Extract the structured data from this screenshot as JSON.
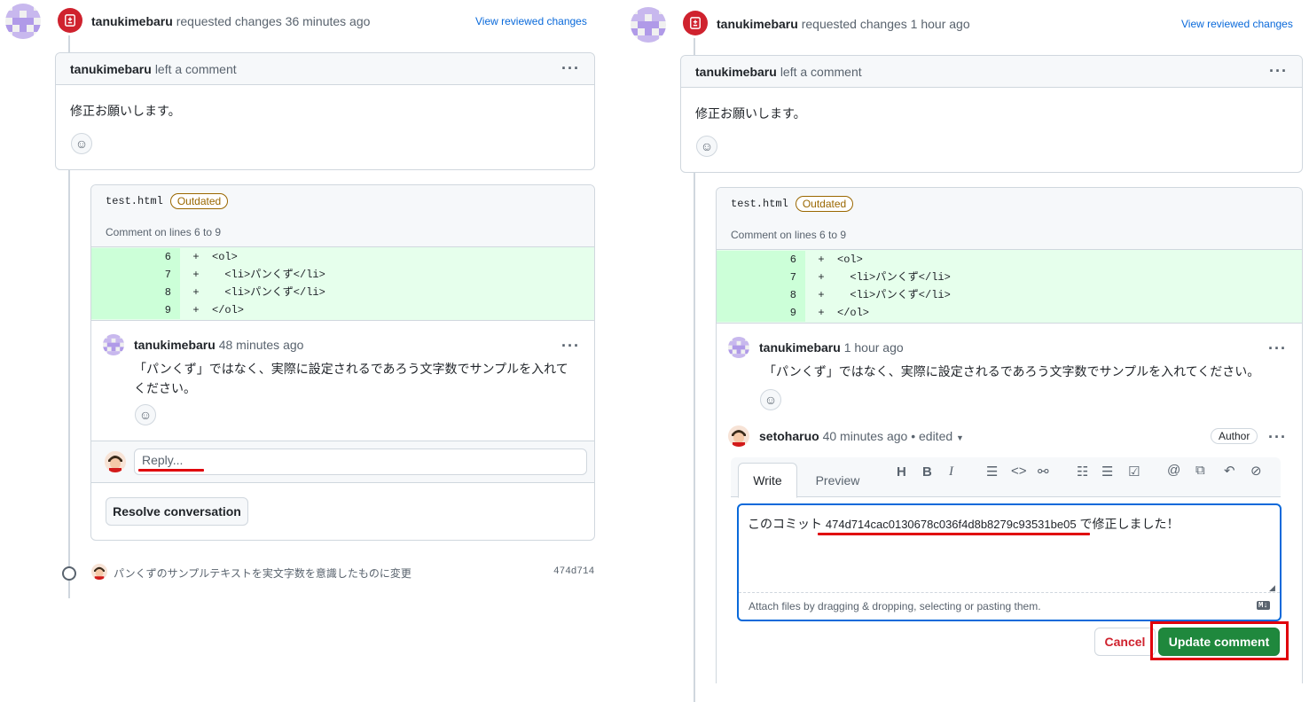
{
  "colors": {
    "accent": "#0969da",
    "danger": "#cf222e",
    "success": "#1f883d",
    "outdated": "#9a6700",
    "diff_add": "#e6ffec",
    "highlight_red": "#e0000b"
  },
  "left": {
    "review": {
      "user": "tanukimebaru",
      "action": "requested changes 36 minutes ago",
      "link": "View reviewed changes"
    },
    "comment": {
      "user": "tanukimebaru",
      "action": "left a comment",
      "body": "修正お願いします。"
    },
    "thread": {
      "file": "test.html",
      "badge": "Outdated",
      "lines_label": "Comment on lines 6 to 9",
      "diff": [
        {
          "num": "6",
          "sign": "+",
          "code": "<ol>"
        },
        {
          "num": "7",
          "sign": "+",
          "code": "  <li>パンくず</li>"
        },
        {
          "num": "8",
          "sign": "+",
          "code": "  <li>パンくず</li>"
        },
        {
          "num": "9",
          "sign": "+",
          "code": "</ol>"
        }
      ],
      "reply": {
        "user": "tanukimebaru",
        "time": "48 minutes ago",
        "body": "「パンくず」ではなく、実際に設定されるであろう文字数でサンプルを入れてください。"
      },
      "reply_placeholder": "Reply...",
      "resolve_label": "Resolve conversation"
    },
    "commit": {
      "message": "パンくずのサンプルテキストを実文字数を意識したものに変更",
      "sha": "474d714"
    }
  },
  "right": {
    "review": {
      "user": "tanukimebaru",
      "action": "requested changes 1 hour ago",
      "link": "View reviewed changes"
    },
    "comment": {
      "user": "tanukimebaru",
      "action": "left a comment",
      "body": "修正お願いします。"
    },
    "thread": {
      "file": "test.html",
      "badge": "Outdated",
      "lines_label": "Comment on lines 6 to 9",
      "diff": [
        {
          "num": "6",
          "sign": "+",
          "code": "<ol>"
        },
        {
          "num": "7",
          "sign": "+",
          "code": "  <li>パンくず</li>"
        },
        {
          "num": "8",
          "sign": "+",
          "code": "  <li>パンくず</li>"
        },
        {
          "num": "9",
          "sign": "+",
          "code": "</ol>"
        }
      ],
      "reply": {
        "user": "tanukimebaru",
        "time": "1 hour ago",
        "body": "「パンくず」ではなく、実際に設定されるであろう文字数でサンプルを入れてください。"
      },
      "edit": {
        "user": "setoharuo",
        "time": "40 minutes ago",
        "edited": "• edited",
        "role": "Author",
        "tabs": {
          "write": "Write",
          "preview": "Preview"
        },
        "text_prefix": "このコミット ",
        "sha": "474d714cac0130678c036f4d8b8279c93531be05",
        "text_suffix": " で修正しました！",
        "attach": "Attach files by dragging & dropping, selecting or pasting them.",
        "md_badge": "M↓",
        "cancel_label": "Cancel",
        "update_label": "Update comment"
      }
    }
  },
  "toolbar_icons": [
    "heading-icon",
    "bold-icon",
    "italic-icon",
    "quote-icon",
    "code-icon",
    "link-icon",
    "bullet-list-icon",
    "numbered-list-icon",
    "task-list-icon",
    "mention-icon",
    "cross-reference-icon",
    "reply-icon",
    "slash-command-icon"
  ]
}
